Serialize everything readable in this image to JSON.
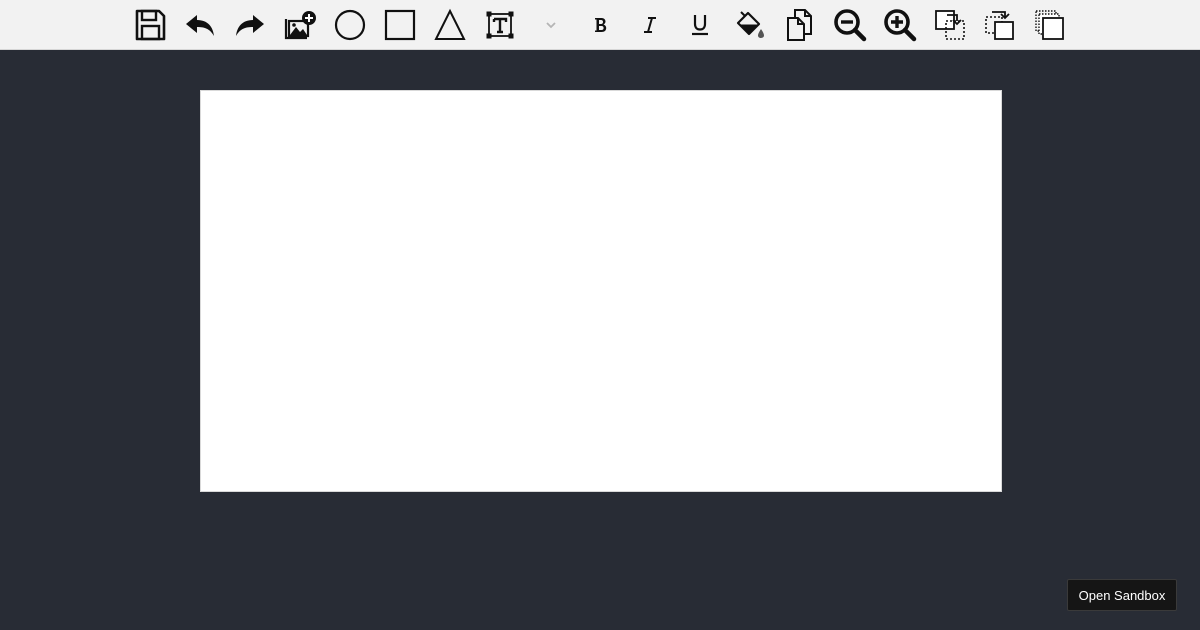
{
  "toolbar": {
    "tools": [
      {
        "name": "save",
        "icon": "save-icon"
      },
      {
        "name": "undo",
        "icon": "undo-icon"
      },
      {
        "name": "redo",
        "icon": "redo-icon"
      },
      {
        "name": "add-image",
        "icon": "add-image-icon"
      },
      {
        "name": "circle",
        "icon": "circle-icon"
      },
      {
        "name": "rectangle",
        "icon": "square-icon"
      },
      {
        "name": "triangle",
        "icon": "triangle-icon"
      },
      {
        "name": "text",
        "icon": "text-box-icon"
      },
      {
        "name": "font-size",
        "icon": "chevron-down-icon"
      },
      {
        "name": "bold",
        "icon": "bold-icon"
      },
      {
        "name": "italic",
        "icon": "italic-icon"
      },
      {
        "name": "underline",
        "icon": "underline-icon"
      },
      {
        "name": "fill",
        "icon": "paint-bucket-icon"
      },
      {
        "name": "copy",
        "icon": "copy-icon"
      },
      {
        "name": "zoom-out",
        "icon": "zoom-out-icon"
      },
      {
        "name": "zoom-in",
        "icon": "zoom-in-icon"
      },
      {
        "name": "bring-forward",
        "icon": "bring-forward-icon"
      },
      {
        "name": "send-backward",
        "icon": "send-backward-icon"
      },
      {
        "name": "send-to-back",
        "icon": "send-to-back-icon"
      }
    ]
  },
  "colors": {
    "background": "#282c35",
    "toolbar": "#f2f2f2",
    "canvas": "#ffffff",
    "icon": "#111111",
    "disabled_icon": "#b5b5b5"
  },
  "sandbox": {
    "label": "Open Sandbox"
  }
}
